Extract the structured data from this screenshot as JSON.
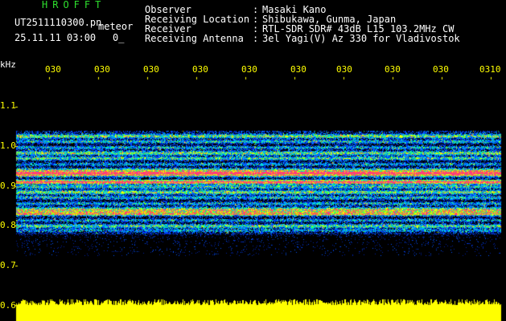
{
  "header": {
    "title": "HROFFT",
    "filename": "UT2511110300.pn",
    "mode": "meteor",
    "datetime": "25.11.11 03:00",
    "counter": "0_",
    "info_labels": [
      "Observer",
      "Receiving Location",
      "Receiver",
      "Receiving Antenna"
    ],
    "info_sep": [
      ":",
      ":",
      ":",
      ":"
    ],
    "info_values": [
      "Masaki Kano",
      "Shibukawa, Gunma, Japan",
      "RTL-SDR SDR# 43dB L15 103.2MHz CW",
      "3el Yagi(V) Az 330 for Vladivostok"
    ]
  },
  "axis": {
    "y_unit": "kHz",
    "y_ticks": [
      "1.1",
      "1.0",
      "0.9",
      "0.8",
      "0.7",
      "0.6"
    ],
    "y_values": [
      1.1,
      1.0,
      0.9,
      0.8,
      0.7,
      0.6
    ],
    "ylim": [
      0.6,
      1.1
    ],
    "time_ticks": [
      "030",
      "030",
      "030",
      "030",
      "030",
      "030",
      "030",
      "030",
      "030",
      "0310"
    ]
  },
  "colors": {
    "background": "#000000",
    "text": "#ffffff",
    "title": "#2ee02e",
    "axis": "#ffff00",
    "noise": "#ffff00",
    "meteor_line": "#ff3a80"
  },
  "spectrogram": {
    "band_kHz": [
      0.78,
      1.04
    ],
    "strong_lines_kHz": [
      0.935,
      0.91,
      0.835
    ]
  }
}
